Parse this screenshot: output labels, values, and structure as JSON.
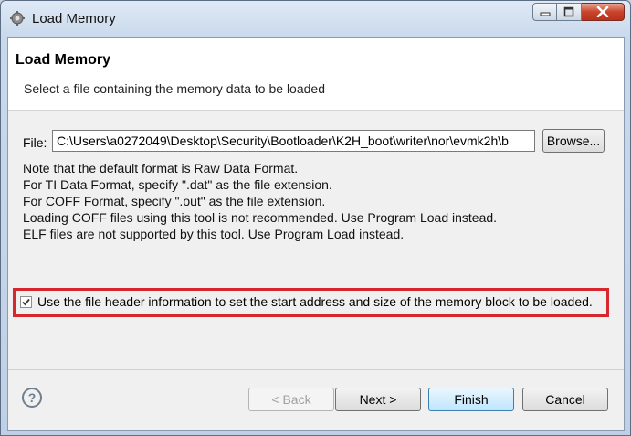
{
  "window": {
    "title": "Load Memory"
  },
  "page": {
    "title": "Load Memory",
    "description": "Select a file containing the memory data to be loaded"
  },
  "file": {
    "label": "File:",
    "value": "C:\\Users\\a0272049\\Desktop\\Security\\Bootloader\\K2H_boot\\writer\\nor\\evmk2h\\b",
    "browse_label": "Browse..."
  },
  "notes": [
    "Note that the default format is Raw Data Format.",
    "For TI Data Format, specify \".dat\" as the file extension.",
    "For COFF Format, specify \".out\" as the file extension.",
    "Loading COFF files using this tool is not recommended. Use Program Load instead.",
    "ELF files are not supported by this tool. Use Program Load instead."
  ],
  "header_option": {
    "checked": true,
    "label": "Use the file header information to set the start address and size of the memory block to be loaded."
  },
  "buttons": {
    "back": "< Back",
    "next": "Next >",
    "finish": "Finish",
    "cancel": "Cancel"
  },
  "icons": {
    "app": "gear-icon",
    "help": "help-icon",
    "minimize": "minimize-icon",
    "maximize": "maximize-icon",
    "close": "close-icon"
  },
  "colors": {
    "highlight_box": "#d6262e",
    "close_button": "#c8442c"
  }
}
